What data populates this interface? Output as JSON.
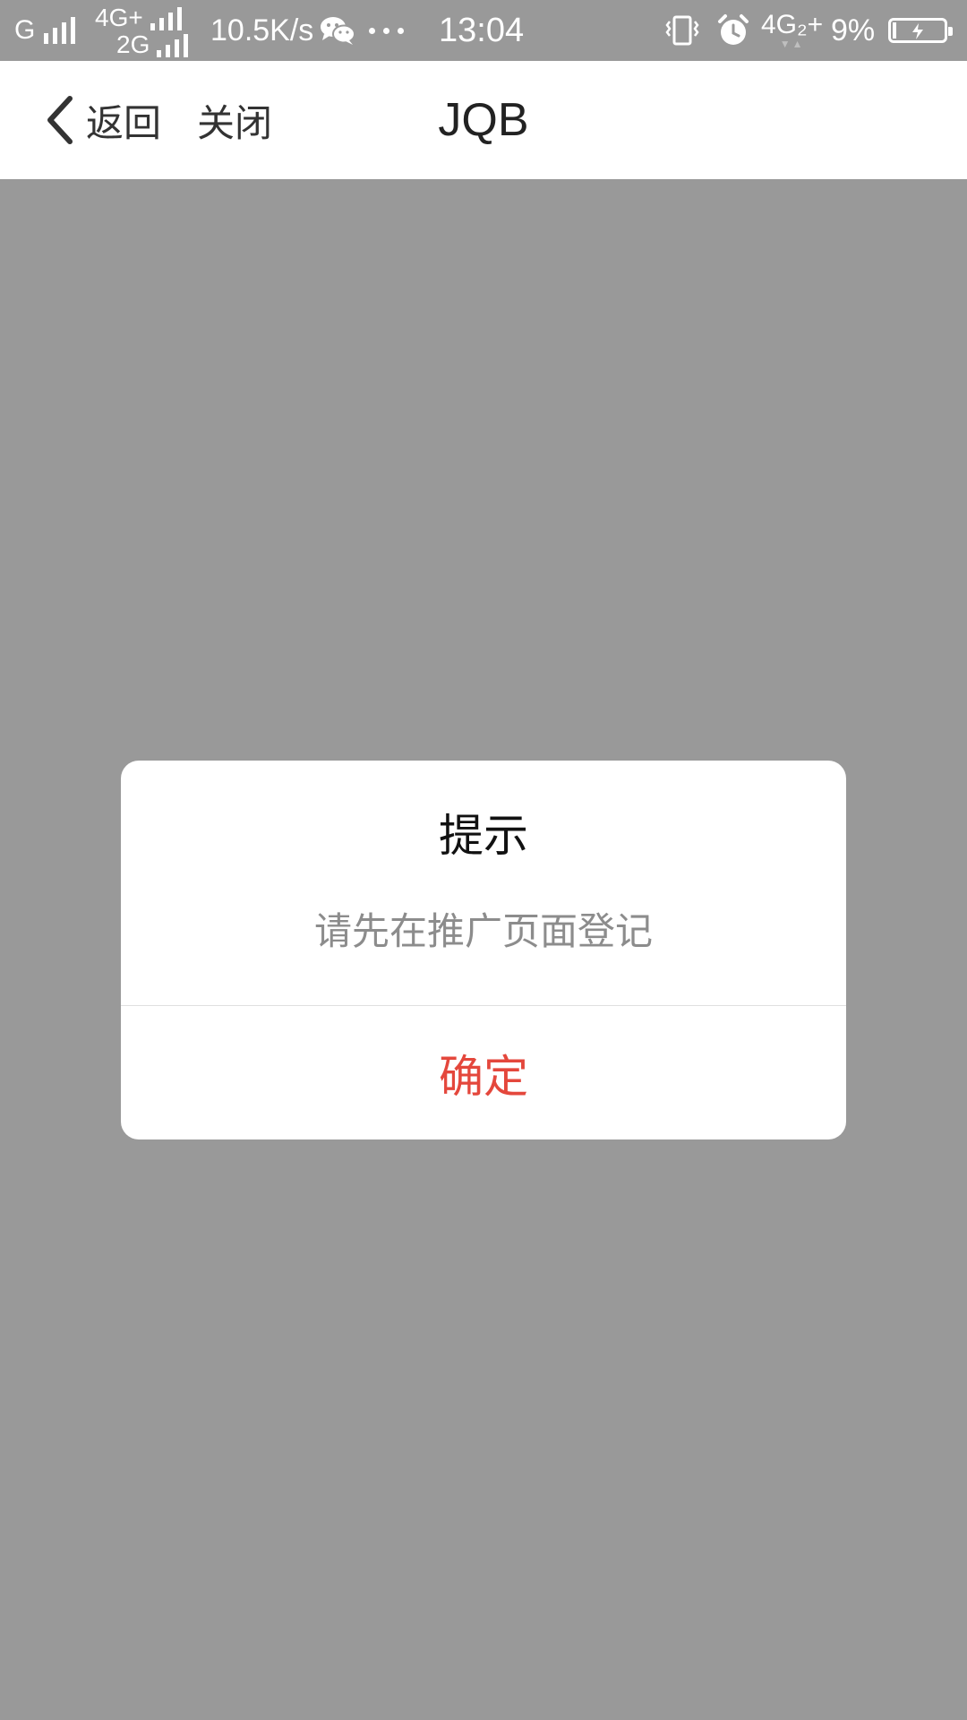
{
  "status_bar": {
    "sim1_label": "G",
    "sim2_top_label": "4G+",
    "sim2_bottom_label": "2G",
    "net_speed": "10.5K/s",
    "time": "13:04",
    "data_label": "4G₂+",
    "battery_percent": "9%",
    "icons": [
      "signal-icon",
      "wechat-icon",
      "more-dots-icon",
      "vibrate-icon",
      "alarm-icon",
      "battery-charging-icon"
    ],
    "text_color": "#ffffff"
  },
  "nav": {
    "back_label": "返回",
    "close_label": "关闭",
    "title": "JQB",
    "back_icon": "chevron-left-icon"
  },
  "dialog": {
    "title": "提示",
    "message": "请先在推广页面登记",
    "confirm_label": "确定",
    "confirm_color": "#e4473c"
  },
  "colors": {
    "overlay_background": "#999999",
    "nav_background": "#ffffff"
  }
}
